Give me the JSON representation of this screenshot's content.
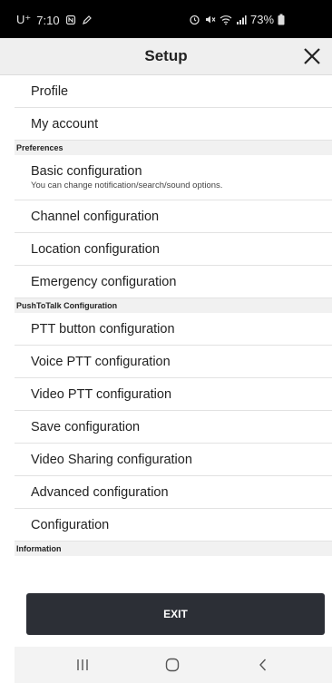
{
  "status_bar": {
    "carrier": "U⁺",
    "time": "7:10",
    "battery": "73%",
    "icons": [
      "nfc-icon",
      "pencil-icon",
      "alarm-icon",
      "mute-icon",
      "wifi-icon",
      "signal-icon",
      "battery-icon"
    ]
  },
  "header": {
    "title": "Setup",
    "close_icon": "close-icon"
  },
  "list": {
    "profile": "Profile",
    "my_account": "My account",
    "preferences_header": "Preferences",
    "basic_configuration": "Basic configuration",
    "basic_configuration_sub": "You can change notification/search/sound options.",
    "channel_configuration": "Channel configuration",
    "location_configuration": "Location configuration",
    "emergency_configuration": "Emergency configuration",
    "ptt_header": "PushToTalk Configuration",
    "ptt_button_configuration": "PTT button configuration",
    "voice_ptt_configuration": "Voice PTT configuration",
    "video_ptt_configuration": "Video PTT configuration",
    "save_configuration": "Save configuration",
    "video_sharing_configuration": "Video Sharing configuration",
    "advanced_configuration": "Advanced configuration",
    "configuration": "Configuration",
    "information_header": "Information"
  },
  "exit_button": {
    "label": "EXIT"
  },
  "nav_bar": {
    "icons": [
      "recent-apps-icon",
      "home-icon",
      "back-icon"
    ]
  },
  "colors": {
    "status_bar": "#000000",
    "header_bg": "#efefef",
    "section_bg": "#f1f1f1",
    "exit_button": "#2c2f36",
    "nav_bar": "#f3f3f3"
  }
}
